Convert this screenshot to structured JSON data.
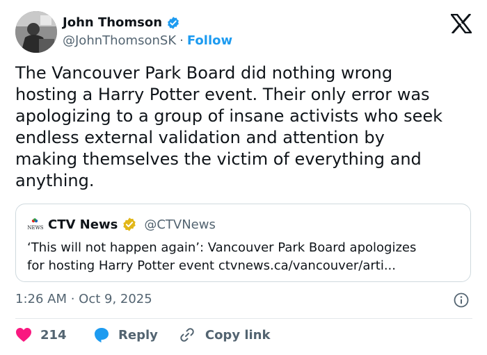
{
  "author": {
    "display_name": "John Thomson",
    "handle": "@JohnThomsonSK",
    "separator": "·",
    "follow_label": "Follow",
    "verified": true
  },
  "tweet": {
    "text_lines": [
      "The Vancouver Park Board did nothing wrong",
      "hosting a Harry Potter event. Their only error was",
      "apologizing to a group of insane activists who seek",
      "endless external validation and attention by",
      "making themselves the victim of everything and",
      "anything."
    ],
    "timestamp": "1:26 AM · Oct 9, 2025"
  },
  "quote": {
    "display_name": "CTV News",
    "handle": "@CTVNews",
    "logo_text": "NEWS",
    "text_lines": [
      "‘This will not happen again’: Vancouver Park Board apologizes",
      "for hosting Harry Potter event ctvnews.ca/vancouver/arti..."
    ]
  },
  "actions": {
    "like_count": "214",
    "reply_label": "Reply",
    "copy_label": "Copy link"
  },
  "colors": {
    "accent": "#1d9bf0",
    "like": "#f91880",
    "gold_badge": "#e2b719",
    "text": "#0f1419",
    "secondary": "#536471"
  },
  "icons": [
    "verified-badge-icon",
    "x-logo-icon",
    "ctv-news-logo",
    "gold-verified-badge-icon",
    "info-icon",
    "heart-icon",
    "reply-bubble-icon",
    "link-icon"
  ]
}
